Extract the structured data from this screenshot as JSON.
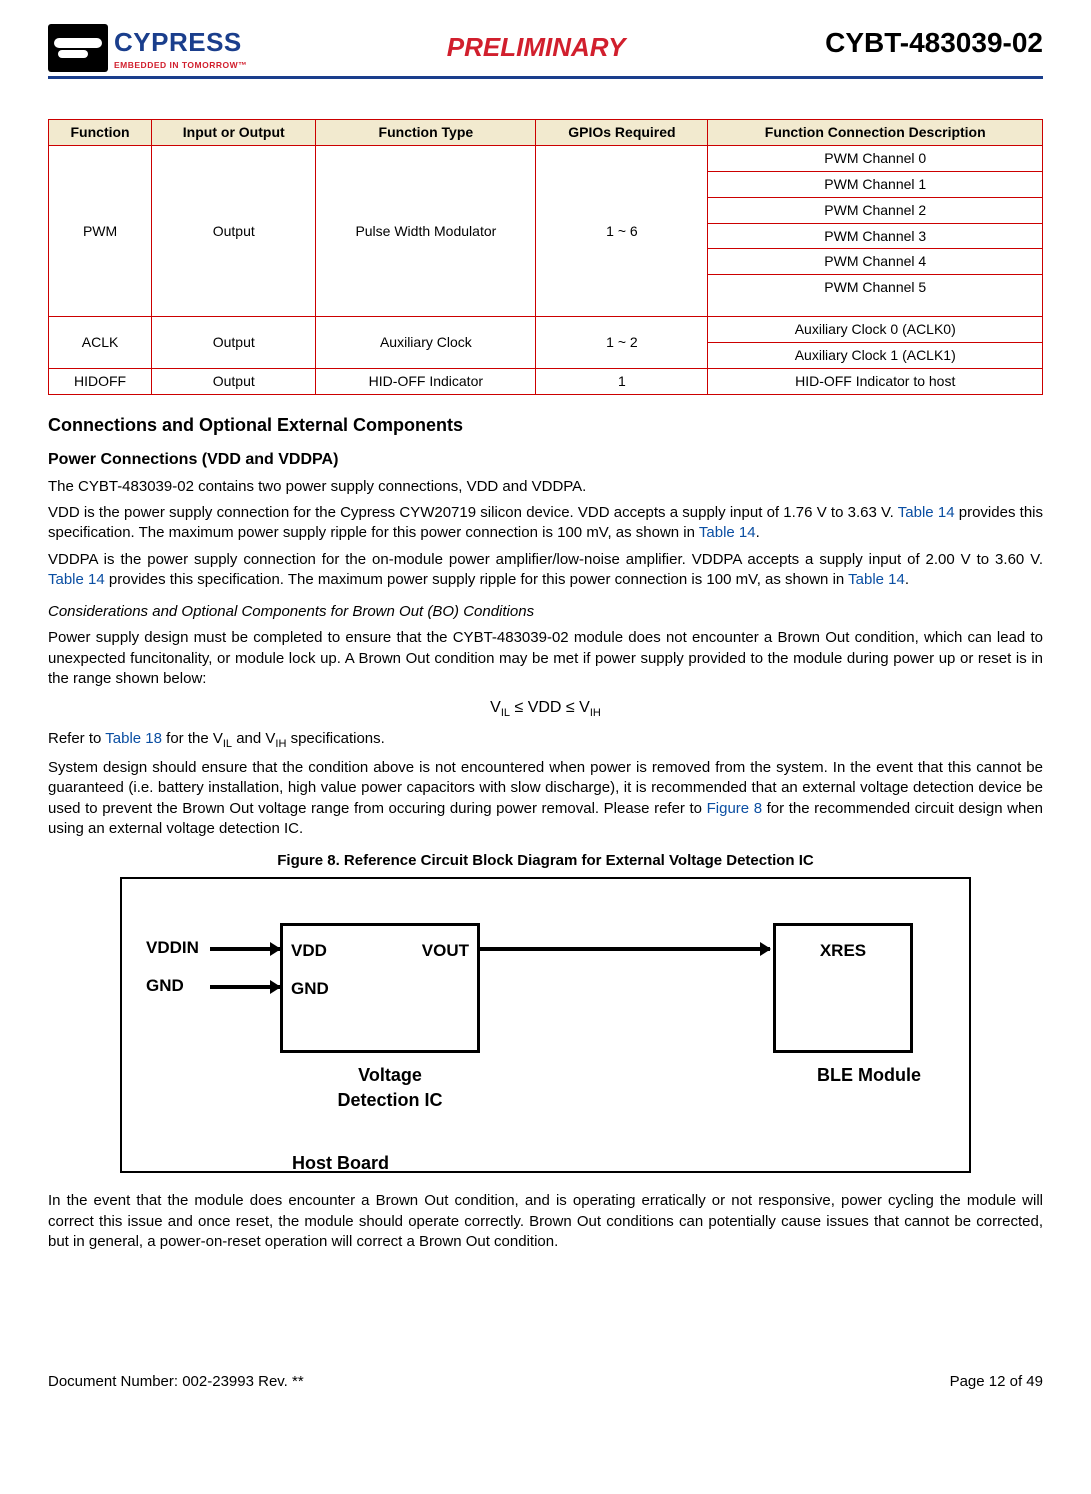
{
  "header": {
    "logo_name": "CYPRESS",
    "logo_tag": "EMBEDDED IN TOMORROW™",
    "preliminary": "PRELIMINARY",
    "part_number": "CYBT-483039-02"
  },
  "table": {
    "headers": [
      "Function",
      "Input or Output",
      "Function Type",
      "GPIOs Required",
      "Function Connection Description"
    ],
    "rows": [
      {
        "function": "PWM",
        "io": "Output",
        "ftype": "Pulse Width Modulator",
        "gpios": "1 ~ 6",
        "conn": [
          "PWM Channel 0",
          "PWM Channel 1",
          "PWM Channel 2",
          "PWM Channel 3",
          "PWM Channel 4",
          "PWM Channel 5"
        ]
      },
      {
        "function": "ACLK",
        "io": "Output",
        "ftype": "Auxiliary Clock",
        "gpios": "1 ~ 2",
        "conn": [
          "Auxiliary Clock 0 (ACLK0)",
          "Auxiliary Clock 1 (ACLK1)"
        ]
      },
      {
        "function": "HIDOFF",
        "io": "Output",
        "ftype": "HID-OFF Indicator",
        "gpios": "1",
        "conn": [
          "HID-OFF Indicator to host"
        ]
      }
    ]
  },
  "sections": {
    "h2": "Connections and Optional External Components",
    "h3": "Power Connections (VDD and VDDPA)",
    "p1": "The CYBT-483039-02 contains two power supply connections, VDD and VDDPA.",
    "p2a": "VDD is the power supply connection for the Cypress CYW20719 silicon device. VDD accepts a supply input of 1.76 V to 3.63 V. ",
    "p2link1": "Table 14",
    "p2b": " provides this specification. The maximum power supply ripple for this power connection is 100 mV, as shown in ",
    "p2link2": "Table 14",
    "p2c": ".",
    "p3a": "VDDPA is the power supply connection for the on-module power amplifier/low-noise amplifier. VDDPA accepts a supply input of 2.00 V to 3.60 V. ",
    "p3link1": "Table 14",
    "p3b": " provides this specification. The maximum power supply ripple for this power connection is 100 mV, as shown in ",
    "p3link2": "Table 14",
    "p3c": ".",
    "italic_h": "Considerations and Optional Components for Brown Out (BO) Conditions",
    "p4": "Power supply design must be completed to ensure that the CYBT-483039-02 module does not encounter a Brown Out condition, which can lead to unexpected funcitonality, or module lock up. A Brown Out condition may be met if power supply provided to the module during power up or reset is in the range shown below:",
    "formula_prefix": "V",
    "formula_il": "IL",
    "formula_mid1": " ≤ VDD ≤ V",
    "formula_ih": "IH",
    "p5a": "Refer to ",
    "p5link": "Table 18",
    "p5b": " for the V",
    "p5c": " and V",
    "p5d": " specifications.",
    "p6a": "System design should ensure that the condition above is not encountered when power is removed from the system. In the event that this cannot be guaranteed (i.e. battery installation, high value power capacitors with slow discharge), it is recommended that an external voltage detection device be used to prevent the Brown Out voltage range from occuring during power removal. Please refer to ",
    "p6link": "Figure 8",
    "p6b": " for the recommended circuit design when using an external voltage detection IC.",
    "fig_title": "Figure 8.  Reference Circuit Block Diagram for External Voltage Detection IC",
    "p7": "In the event that the module does encounter a Brown Out condition, and is operating erratically or not responsive, power cycling the module will correct this issue and once reset, the module should operate correctly. Brown Out conditions can potentially cause issues that cannot be corrected, but in general, a power-on-reset operation will correct a Brown Out condition."
  },
  "diagram": {
    "vddin": "VDDIN",
    "gnd_left": "GND",
    "vdd": "VDD",
    "gnd_box": "GND",
    "vout": "VOUT",
    "xres": "XRES",
    "det_caption": "Voltage\nDetection IC",
    "ble_caption": "BLE Module",
    "hostboard": "Host Board"
  },
  "footer": {
    "left": "Document Number: 002-23993 Rev. **",
    "right": "Page 12 of 49"
  }
}
